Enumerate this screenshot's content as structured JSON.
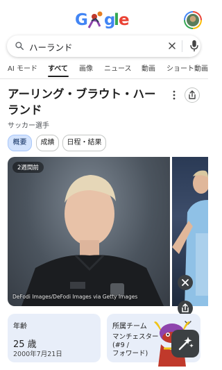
{
  "header": {
    "logo_text": "Google",
    "avatar_icon": "avatar-icon"
  },
  "search": {
    "query": "ハーランド"
  },
  "tabs": [
    {
      "label": "AI モード"
    },
    {
      "label": "すべて",
      "active": true
    },
    {
      "label": "画像"
    },
    {
      "label": "ニュース"
    },
    {
      "label": "動画"
    },
    {
      "label": "ショート動画"
    }
  ],
  "entity": {
    "title": "アーリング・ブラウト・ハーランド",
    "subtitle": "サッカー選手"
  },
  "chips": [
    {
      "label": "概要",
      "selected": true
    },
    {
      "label": "成績"
    },
    {
      "label": "日程・結果"
    }
  ],
  "images": {
    "date_badge": "2週間前",
    "credit": "DeFodi Images/DeFodi Images via Getty Images"
  },
  "facts": {
    "age_label": "年齢",
    "age_value": "25 歳",
    "birth_date": "2000年7月21日",
    "team_label": "所属チーム",
    "team_line1": "マンチェスター",
    "team_line2": "(#9 /",
    "team_line3": "フォワード)"
  },
  "colors": {
    "accent": "#1a73e8",
    "chip_selected": "#d3e3fd",
    "card_bg": "#e8eef9",
    "fab_bg": "#3c4043"
  }
}
